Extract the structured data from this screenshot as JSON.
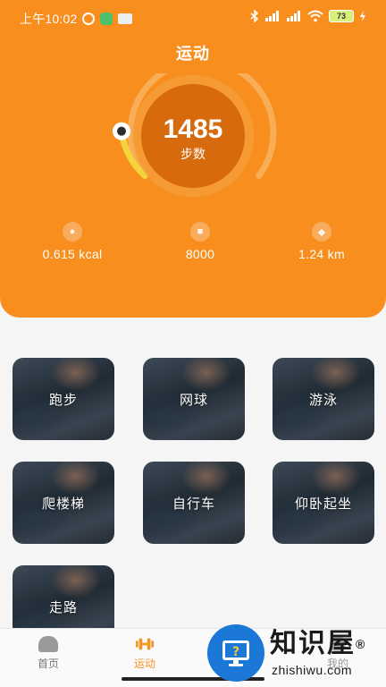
{
  "status_bar": {
    "time": "上午10:02",
    "battery": "73",
    "icons": [
      "alarm-icon",
      "app-notification-icon",
      "chat-notification-icon",
      "bluetooth-icon",
      "signal-icon",
      "signal-icon-2",
      "wifi-icon",
      "battery-icon",
      "charging-icon"
    ]
  },
  "header": {
    "title": "运动"
  },
  "steps": {
    "count": "1485",
    "label": "步数",
    "progress_fraction": 0.25
  },
  "stats": [
    {
      "icon": "calorie-icon",
      "value": "0.615 kcal"
    },
    {
      "icon": "target-icon",
      "value": "8000"
    },
    {
      "icon": "distance-icon",
      "value": "1.24 km"
    }
  ],
  "sports": [
    {
      "label": "跑步"
    },
    {
      "label": "网球"
    },
    {
      "label": "游泳"
    },
    {
      "label": "爬楼梯"
    },
    {
      "label": "自行车"
    },
    {
      "label": "仰卧起坐"
    },
    {
      "label": "走路"
    }
  ],
  "nav": [
    {
      "label": "首页",
      "icon": "home-icon"
    },
    {
      "label": "运动",
      "icon": "dumbbell-icon",
      "active": true
    },
    {
      "label": "我的",
      "icon": "profile-icon"
    }
  ],
  "watermark": {
    "name": "知识屋",
    "registered": "®",
    "url": "zhishiwu.com"
  },
  "colors": {
    "accent": "#f78e1e",
    "active_nav": "#f39322",
    "progress": "#f3d43a"
  }
}
